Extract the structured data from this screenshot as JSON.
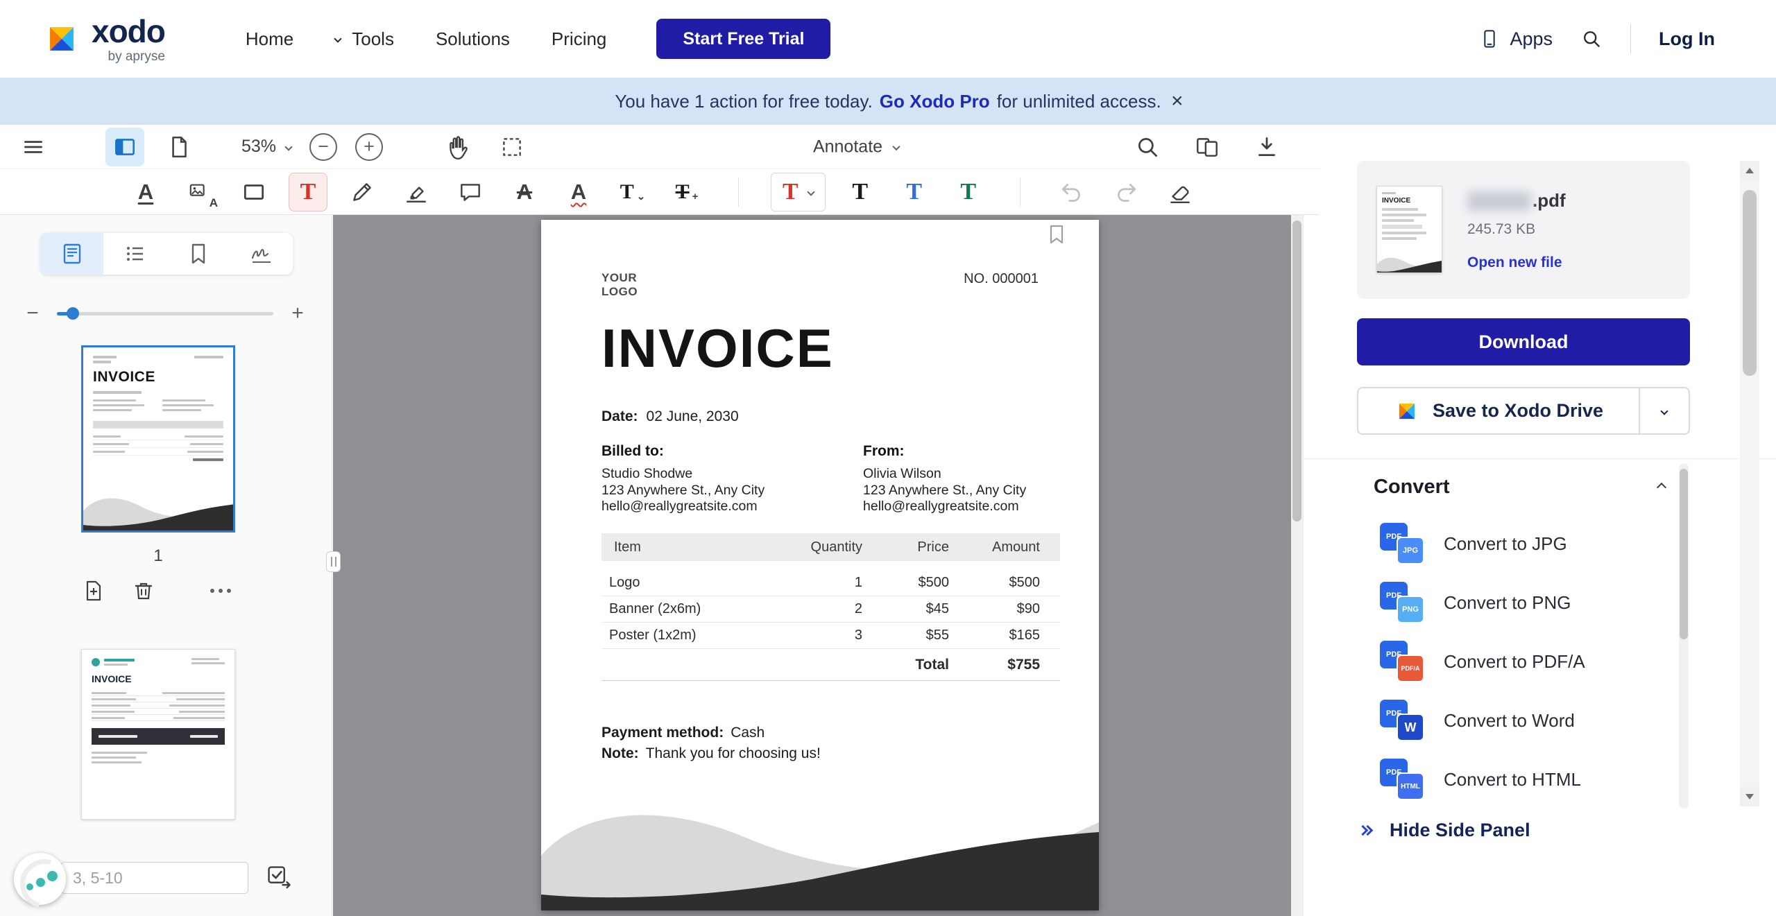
{
  "nav": {
    "brand": "xodo",
    "byline": "by apryse",
    "links": [
      "Home",
      "Tools",
      "Solutions",
      "Pricing"
    ],
    "cta": "Start Free Trial",
    "apps_label": "Apps",
    "login_label": "Log In"
  },
  "banner": {
    "text_pre": "You have 1 action for free today.",
    "link_text": "Go Xodo Pro",
    "text_post": "for unlimited access.",
    "close": "×"
  },
  "toolbar": {
    "zoom_value": "53%",
    "mode": "Annotate"
  },
  "sidebar": {
    "page1_label": "1",
    "pages_placeholder": "3, 5-10"
  },
  "invoice": {
    "logo_line1": "YOUR",
    "logo_line2": "LOGO",
    "number": "NO. 000001",
    "title": "INVOICE",
    "date_label": "Date:",
    "date_value": "02 June, 2030",
    "billed_label": "Billed to:",
    "billed_lines": [
      "Studio Shodwe",
      "123 Anywhere St., Any City",
      "hello@reallygreatsite.com"
    ],
    "from_label": "From:",
    "from_lines": [
      "Olivia Wilson",
      "123 Anywhere St., Any City",
      "hello@reallygreatsite.com"
    ],
    "table": {
      "headers": [
        "Item",
        "Quantity",
        "Price",
        "Amount"
      ],
      "rows": [
        [
          "Logo",
          "1",
          "$500",
          "$500"
        ],
        [
          "Banner (2x6m)",
          "2",
          "$45",
          "$90"
        ],
        [
          "Poster (1x2m)",
          "3",
          "$55",
          "$165"
        ]
      ],
      "total_label": "Total",
      "total_value": "$755"
    },
    "payment_label": "Payment method:",
    "payment_value": "Cash",
    "note_label": "Note:",
    "note_value": "Thank you for choosing us!"
  },
  "panel": {
    "file": {
      "name": ".pdf",
      "size": "245.73 KB",
      "open_new": "Open new file"
    },
    "download_label": "Download",
    "save_drive_label": "Save to Xodo Drive",
    "convert_title": "Convert",
    "back_badge": "PDF",
    "convert_items": [
      {
        "label": "Convert to JPG",
        "fmt": "JPG",
        "color": "#4b8df8"
      },
      {
        "label": "Convert to PNG",
        "fmt": "PNG",
        "color": "#56aef5"
      },
      {
        "label": "Convert to PDF/A",
        "fmt": "PDF/A",
        "color": "#e8593a"
      },
      {
        "label": "Convert to Word",
        "fmt": "W",
        "color": "#1e49c8"
      },
      {
        "label": "Convert to HTML",
        "fmt": "HTML",
        "color": "#3f6ff0"
      }
    ],
    "hide_panel_label": "Hide Side Panel"
  },
  "colors": {
    "accent_indigo": "#211ca5",
    "banner_bg": "#d5e3f7",
    "link_blue": "#2733cc",
    "selection_blue": "#2d7dd2"
  }
}
